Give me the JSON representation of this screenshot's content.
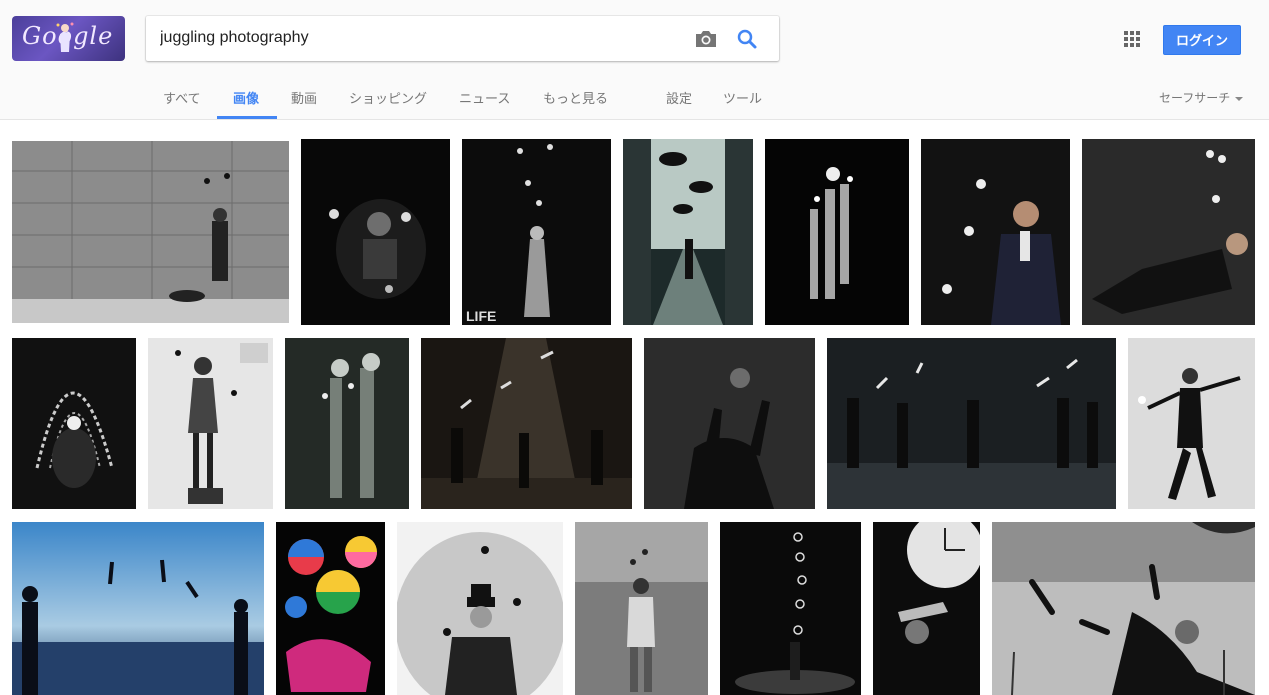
{
  "logo": {
    "text": "Google",
    "icon": "google-doodle-juggler"
  },
  "search": {
    "query": "juggling photography",
    "placeholder": ""
  },
  "icons": {
    "camera": "camera-icon",
    "search": "search-icon",
    "apps": "apps-grid-icon"
  },
  "header": {
    "login_label": "ログイン"
  },
  "tabs": [
    {
      "label": "すべて"
    },
    {
      "label": "画像"
    },
    {
      "label": "動画"
    },
    {
      "label": "ショッピング"
    },
    {
      "label": "ニュース"
    },
    {
      "label": "もっと見る"
    },
    {
      "label": "設定"
    },
    {
      "label": "ツール"
    }
  ],
  "active_tab": "画像",
  "safe_search": "セーフサーチ",
  "colors": {
    "accent": "#4285f4",
    "header_bg": "#fafafa",
    "tab_text": "#777777"
  },
  "results": [
    {
      "row": 1,
      "tone": "grayscale",
      "subject": "street-juggler-wall"
    },
    {
      "row": 1,
      "tone": "dark",
      "subject": "juggler-balls-dark"
    },
    {
      "row": 1,
      "tone": "dark",
      "subject": "life-juggler-clubs",
      "caption": "LIFE"
    },
    {
      "row": 1,
      "tone": "teal",
      "subject": "umbrellas-street"
    },
    {
      "row": 1,
      "tone": "dark",
      "subject": "multiple-exposure-juggler"
    },
    {
      "row": 1,
      "tone": "dark",
      "subject": "man-suit-juggling"
    },
    {
      "row": 1,
      "tone": "dark",
      "subject": "reclining-juggler"
    },
    {
      "row": 2,
      "tone": "dark",
      "subject": "light-trail-arches"
    },
    {
      "row": 2,
      "tone": "grayscale",
      "subject": "woman-on-chair"
    },
    {
      "row": 2,
      "tone": "dark",
      "subject": "double-exposure-juggler"
    },
    {
      "row": 2,
      "tone": "sepia",
      "subject": "stage-juggling-show"
    },
    {
      "row": 2,
      "tone": "dark",
      "subject": "silhouette-reaching"
    },
    {
      "row": 2,
      "tone": "dark",
      "subject": "stage-group-clubs"
    },
    {
      "row": 2,
      "tone": "grayscale",
      "subject": "dancer-juggler"
    },
    {
      "row": 3,
      "tone": "blue",
      "subject": "beach-silhouettes-clubs"
    },
    {
      "row": 3,
      "tone": "color",
      "subject": "beach-balls"
    },
    {
      "row": 3,
      "tone": "grayscale",
      "subject": "bowler-hat-juggler"
    },
    {
      "row": 3,
      "tone": "grayscale",
      "subject": "circus-strongman"
    },
    {
      "row": 3,
      "tone": "dark",
      "subject": "ring-trail-stage"
    },
    {
      "row": 3,
      "tone": "dark",
      "subject": "clock-juggler"
    },
    {
      "row": 3,
      "tone": "grayscale",
      "subject": "palm-juggler-clubs"
    }
  ]
}
